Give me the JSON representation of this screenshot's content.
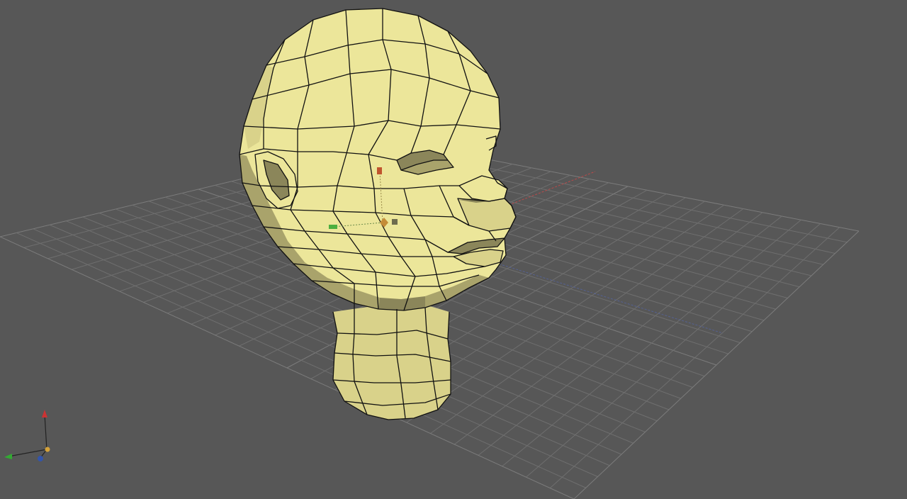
{
  "viewport": {
    "background_color": "#575757",
    "grid_color": "#6f6f6f",
    "mesh_color": "#ece69a",
    "mesh_shadow_color": "#8b865a",
    "wire_color": "#111111",
    "axis_x_color": "#cc3333",
    "axis_y_color": "#33aa33",
    "axis_z_color": "#3355aa"
  },
  "scene": {
    "object": "head-mesh",
    "pivot_gizmo": "transform-gizmo",
    "orientation_widget": "axis-orientation-widget"
  }
}
